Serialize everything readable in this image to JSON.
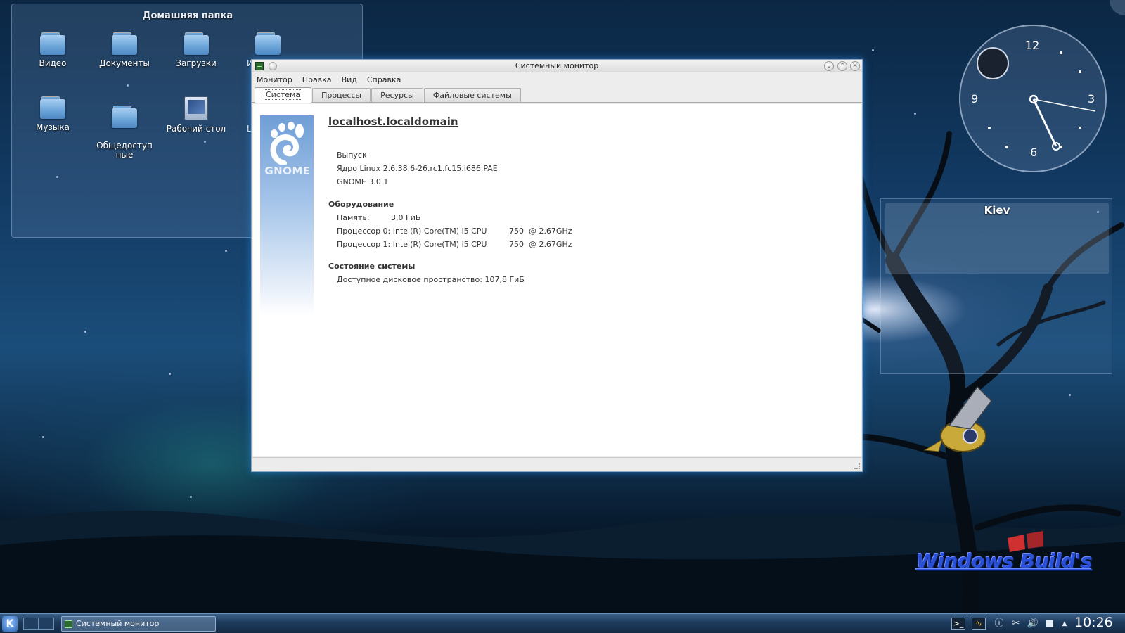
{
  "desktop": {
    "folderview": {
      "title": "Домашняя папка",
      "items": [
        {
          "label": "Видео"
        },
        {
          "label": "Документы"
        },
        {
          "label": "Загрузки"
        },
        {
          "label": "Из"
        },
        {
          "label": "Музыка"
        },
        {
          "label": "Общедоступ\nные"
        },
        {
          "label": "Рабочий стол"
        },
        {
          "label": "L"
        }
      ]
    },
    "clock": {
      "n12": "12",
      "n3": "3",
      "n6": "6",
      "n9": "9"
    },
    "weather": {
      "city": "Kiev"
    },
    "watermark": {
      "text": "Windows Build's"
    }
  },
  "window": {
    "title": "Системный монитор",
    "menu": [
      "Монитор",
      "Правка",
      "Вид",
      "Справка"
    ],
    "tabs": [
      "Система",
      "Процессы",
      "Ресурсы",
      "Файловые системы"
    ],
    "active_tab": "Система",
    "system": {
      "hostname": "localhost.localdomain",
      "logo_text": "GNOME",
      "release_label": "Выпуск",
      "kernel": "Ядро Linux 2.6.38.6-26.rc1.fc15.i686.PAE",
      "gnome_version": "GNOME 3.0.1",
      "hardware_heading": "Оборудование",
      "memory_label": "Память:",
      "memory_value": "3,0 ГиБ",
      "cpu0": "Процессор 0: Intel(R) Core(TM) i5 CPU         750  @ 2.67GHz",
      "cpu1": "Процессор 1: Intel(R) Core(TM) i5 CPU         750  @ 2.67GHz",
      "status_heading": "Состояние системы",
      "disk": "Доступное дисковое пространство: 107,8 ГиБ"
    }
  },
  "taskbar": {
    "k_label": "K",
    "task_label": "Системный монитор",
    "clock": "10:26"
  },
  "colors": {
    "accent": "#2f67b4",
    "window_glow": "#288ce6",
    "watermark": "#2a50d8"
  }
}
